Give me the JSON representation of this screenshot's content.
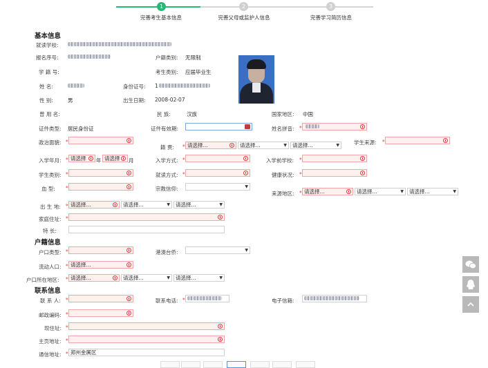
{
  "steps": [
    {
      "num": "1",
      "label": "完善考生基本信息",
      "active": true
    },
    {
      "num": "2",
      "label": "完善父母或监护人信息",
      "active": false
    },
    {
      "num": "3",
      "label": "完善学习简历信息",
      "active": false
    }
  ],
  "sections": {
    "basic": "基本信息",
    "hukou": "户籍信息",
    "contact": "联系信息"
  },
  "labels": {
    "school": "就读学校:",
    "regno": "报名序号:",
    "hukou_type": "户籍类别:",
    "xuejihao": "学 籍 号:",
    "exam_type": "考生类别:",
    "name": "姓    名:",
    "idno": "身份证号:",
    "gender": "性    别:",
    "birthday": "出生日期:",
    "used_name": "曾 用 名:",
    "ethnic": "民    族:",
    "country": "国家地区:",
    "cert_type": "证件类型:",
    "cert_valid": "证件有效期:",
    "pinyin": "姓名拼音:",
    "politics": "政治面貌:",
    "jiguan": "籍    贯:",
    "source": "学生来源:",
    "enroll_date": "入学年月:",
    "enroll_way": "入学方式:",
    "prev_school": "入学前学校:",
    "stu_type": "学生类别:",
    "study_way": "就读方式:",
    "health": "健康状况:",
    "blood": "血    型:",
    "religion": "宗教信仰:",
    "source_area": "来源地区:",
    "birthplace": "出 生 地:",
    "home_addr": "家庭住址:",
    "specialty": "特    长:",
    "hukou_kind": "户口类型:",
    "hk_tw": "港澳台侨:",
    "floating": "流动人口:",
    "hukou_area": "户口所在地区:",
    "contact": "联 系 人:",
    "phone": "联系电话:",
    "email": "电子信箱:",
    "postcode": "邮政编码:",
    "cur_addr": "现住址:",
    "homepage": "主页地址:",
    "mail_addr": "通信地址:"
  },
  "values": {
    "hukou_type": "无限制",
    "exam_type": "应届毕业生",
    "idno_prefix": "1",
    "gender": "男",
    "birthday": "2008-02-07",
    "ethnic": "汉族",
    "country": "中国",
    "cert_type": "居民身份证",
    "mail_addr": "郑州金属区"
  },
  "placeholders": {
    "select": "请选择...",
    "select_short": "请选择"
  },
  "units": {
    "year": "年",
    "month": "月"
  },
  "required_mark": "*",
  "colors": {
    "accent": "#2bb673",
    "required_border": "#f2a5a5",
    "required_bg": "#fff0f0",
    "sidebar": "#b9b9b9"
  },
  "sidebar": [
    {
      "icon": "wechat-icon"
    },
    {
      "icon": "qq-icon"
    },
    {
      "icon": "back-to-top-icon"
    }
  ]
}
